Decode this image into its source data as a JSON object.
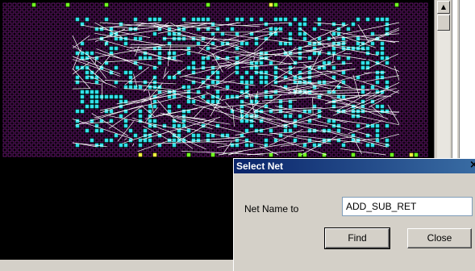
{
  "dialog": {
    "title": "Select Net",
    "close_glyph": "×",
    "net_label": "Net Name to",
    "net_value": "ADD_SUB_RET",
    "find_label": "Find",
    "close_label": "Close"
  },
  "scrollbar": {
    "up_glyph": "▲"
  },
  "colors": {
    "background": "#000000",
    "grid_cell": "#a020b0",
    "highlight_cell": "#30e0e8",
    "io_pad": "#70ff20",
    "io_pad_yellow": "#f0f040",
    "net_lines": "#ffffff",
    "dialog_title": "#0a246a"
  }
}
